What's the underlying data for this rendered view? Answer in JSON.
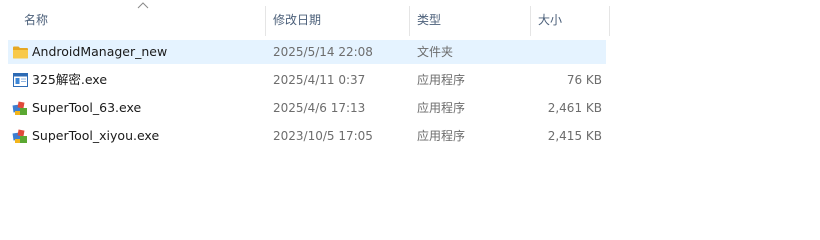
{
  "columns": {
    "name": "名称",
    "date": "修改日期",
    "type": "类型",
    "size": "大小"
  },
  "sort": {
    "column": "name",
    "direction": "ascending"
  },
  "files": [
    {
      "name": "AndroidManager_new",
      "date": "2025/5/14 22:08",
      "type": "文件夹",
      "size": "",
      "icon": "folder-icon",
      "selected": true
    },
    {
      "name": "325解密.exe",
      "date": "2025/4/11 0:37",
      "type": "应用程序",
      "size": "76 KB",
      "icon": "application-window-icon",
      "selected": false
    },
    {
      "name": "SuperTool_63.exe",
      "date": "2025/4/6 17:13",
      "type": "应用程序",
      "size": "2,461 KB",
      "icon": "application-exe-icon",
      "selected": false
    },
    {
      "name": "SuperTool_xiyou.exe",
      "date": "2023/10/5 17:05",
      "type": "应用程序",
      "size": "2,415 KB",
      "icon": "application-exe-icon",
      "selected": false
    }
  ],
  "colors": {
    "selection": "#e5f3ff",
    "header_text": "#4c607a",
    "folder_yellow": "#f8c94a"
  }
}
